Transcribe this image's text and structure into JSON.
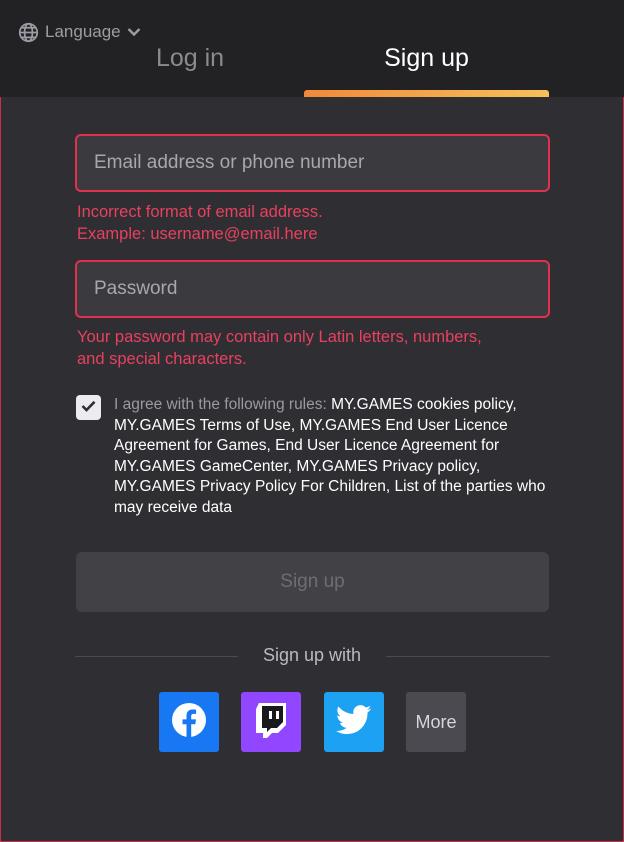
{
  "header": {
    "language_label": "Language",
    "tabs": [
      {
        "label": "Log in",
        "active": false
      },
      {
        "label": "Sign up",
        "active": true
      }
    ]
  },
  "form": {
    "email": {
      "value": "",
      "placeholder": "Email address or phone number"
    },
    "email_error_line1": "Incorrect format of email address.",
    "email_error_line2": "Example: username@email.here",
    "password": {
      "value": "",
      "placeholder": "Password"
    },
    "password_error_line1": "Your password may contain only Latin letters, numbers,",
    "password_error_line2": "and special characters.",
    "agree_checked": true,
    "agree_prefix": "I agree with the following rules:",
    "links": [
      "MY.GAMES cookies policy",
      "MY.GAMES Terms of Use",
      "MY.GAMES End User Licence Agreement for Games",
      "End User Licence Agreement for MY.GAMES GameCenter",
      "MY.GAMES Privacy policy",
      "MY.GAMES Privacy Policy For Children",
      "List of the parties who may receive data"
    ],
    "submit_label": "Sign up"
  },
  "social": {
    "label": "Sign up with",
    "providers": [
      {
        "name": "facebook",
        "icon": "facebook-icon",
        "color": "#1877f2"
      },
      {
        "name": "twitch",
        "icon": "twitch-icon",
        "color": "#9146ff"
      },
      {
        "name": "twitter",
        "icon": "twitter-icon",
        "color": "#1da1f2"
      }
    ],
    "more_label": "More"
  },
  "colors": {
    "error": "#e8405e",
    "accent_gradient_start": "#f08a3a",
    "accent_gradient_end": "#f7c05a"
  }
}
